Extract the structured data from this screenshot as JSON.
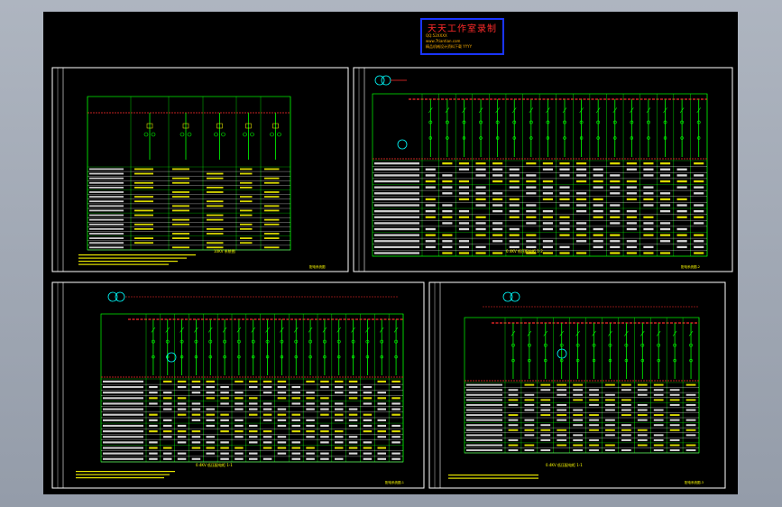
{
  "window": {
    "background": "#000000",
    "frame_color": "#ffffff"
  },
  "stamp": {
    "title": "天天工作室录制",
    "lines": [
      "QQ:52XXXX",
      "www.7tiantian.com",
      "精品机械设计资料下载 YYYY"
    ],
    "border_color": "#1a35ff",
    "title_color": "#ff2a2a"
  },
  "sheets": [
    {
      "id": "sheet-1",
      "caption": "10KV 系统图",
      "tag": "配电系统图",
      "bay_count": 5,
      "bus_bars": 0
    },
    {
      "id": "sheet-2",
      "caption": "0.4KV 低压配电柜 1-2",
      "tag": "配电系统图-2",
      "bay_count": 17,
      "bus_bars": 1
    },
    {
      "id": "sheet-3",
      "caption": "0.4KV 低压配电柜 1-1",
      "tag": "配电系统图-1",
      "bay_count": 18,
      "bus_bars": 1
    },
    {
      "id": "sheet-4",
      "caption": "0.4KV 低压配电柜 1-1",
      "tag": "配电系统图-3",
      "bay_count": 12,
      "bus_bars": 1
    }
  ],
  "colors": {
    "line": "#00ff00",
    "dashed": "#ff2a2a",
    "table": "#ffffff",
    "text": "#ffff00",
    "device": "#00ffff"
  }
}
